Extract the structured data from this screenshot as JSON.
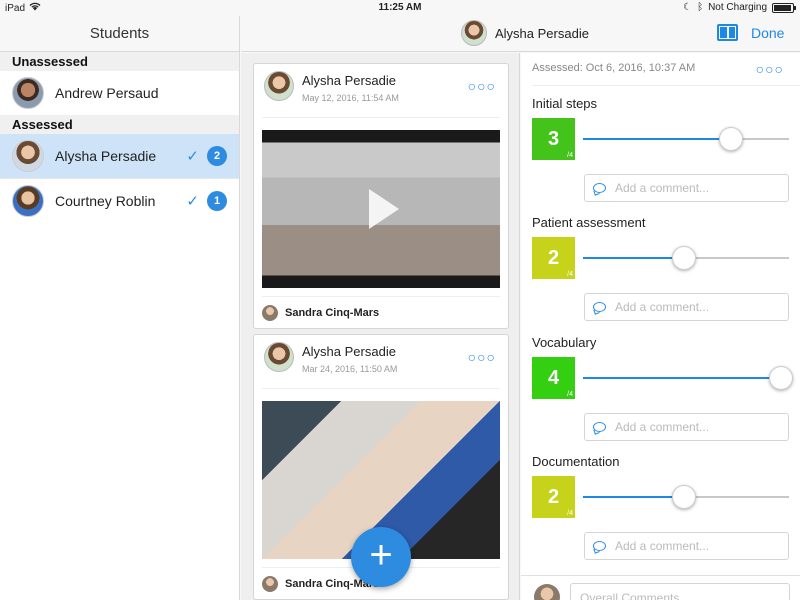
{
  "status_bar": {
    "device": "iPad",
    "time": "11:25 AM",
    "charging": "Not Charging"
  },
  "left_panel": {
    "title": "Students",
    "sections": [
      {
        "heading": "Unassessed",
        "students": [
          {
            "name": "Andrew Persaud"
          }
        ]
      },
      {
        "heading": "Assessed",
        "students": [
          {
            "name": "Alysha Persadie",
            "count": "2",
            "selected": true
          },
          {
            "name": "Courtney Roblin",
            "count": "1"
          }
        ]
      }
    ]
  },
  "header": {
    "student_name": "Alysha Persadie",
    "done_label": "Done"
  },
  "feed": {
    "posts": [
      {
        "author": "Alysha Persadie",
        "date": "May 12, 2016, 11:54 AM",
        "media": "video",
        "commenter": "Sandra Cinq-Mars"
      },
      {
        "author": "Alysha Persadie",
        "date": "Mar 24, 2016, 11:50 AM",
        "media": "photo",
        "commenter": "Sandra Cinq-Mars"
      }
    ],
    "fab_label": "+"
  },
  "assessment": {
    "assessed_text": "Assessed: Oct 6, 2016, 10:37 AM",
    "criteria": [
      {
        "title": "Initial steps",
        "score": "3",
        "max": "/4",
        "color": "#44c31a",
        "level": 0.72
      },
      {
        "title": "Patient assessment",
        "score": "2",
        "max": "/4",
        "color": "#c7d31a",
        "level": 0.49
      },
      {
        "title": "Vocabulary",
        "score": "4",
        "max": "/4",
        "color": "#35cf12",
        "level": 0.96
      },
      {
        "title": "Documentation",
        "score": "2",
        "max": "/4",
        "color": "#c7d31a",
        "level": 0.49
      }
    ],
    "comment_placeholder": "Add a comment...",
    "overall_placeholder": "Overall Comments"
  }
}
